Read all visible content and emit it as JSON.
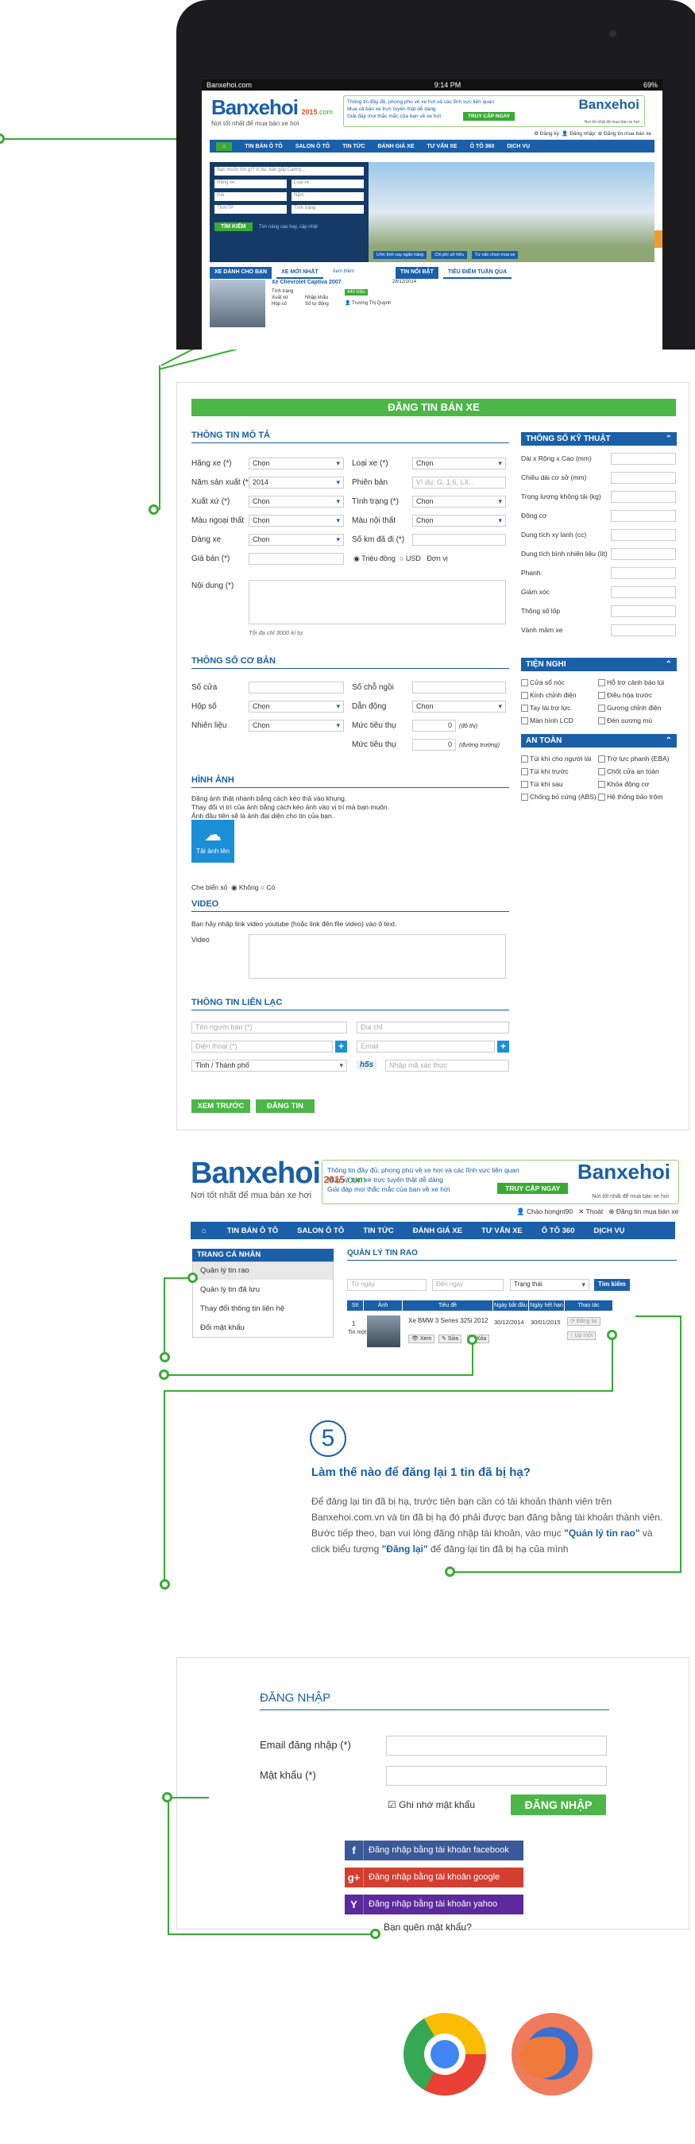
{
  "tablet": {
    "status": {
      "carrier": "Banxehoi.com",
      "time": "9:14 PM",
      "battery": "69%"
    },
    "logo": {
      "brand": "Banxehoi",
      "year": "2015",
      "suffix": ".com",
      "tagline": "Nơi tốt nhất để mua bán xe hơi"
    },
    "ad": {
      "line1": "Thông tin đầy đủ, phong phú về xe hơi và các lĩnh vực liên quan",
      "line2": "Mua và bán xe trực tuyến thật dễ dàng",
      "line3": "Giải đáp mọi thắc mắc của bạn về xe hơi",
      "cta": "TRUY CẬP NGAY",
      "brand": "Banxehoi",
      "tagline": "Nơi tốt nhất để mua bán xe hơi"
    },
    "userbar": [
      "Đăng ký",
      "Đăng nhập",
      "Đăng tin mua bán xe"
    ],
    "nav": [
      "TIN BÁN Ô TÔ",
      "SALON Ô TÔ",
      "TIN TỨC",
      "ĐÁNH GIÁ XE",
      "TƯ VẤN XE",
      "Ô TÔ 360",
      "DỊCH VỤ"
    ],
    "search": {
      "placeholder": "Bạn muốn tìm gì? ví dụ: bán gấp Camry...",
      "f1": "Hãng xe",
      "f2": "Loại xe",
      "f3": "Giá",
      "f4": "Năm",
      "f5": "Tỉnh/TP",
      "f6": "Tình trạng",
      "button": "TÌM KIẾM",
      "link": "Tìm nâng cao hay, cập nhật"
    },
    "banner_chips": [
      "Ước tính vay ngân hàng",
      "Chi phí sở hữu",
      "Tư vấn chọn mua xe"
    ],
    "tabs": [
      "XE DÀNH CHO BẠN",
      "XE MỚI NHẤT",
      "Xem thêm",
      "TIN NỔI BẬT",
      "TIÊU ĐIỂM TUẦN QUA"
    ],
    "car": {
      "title": "Xe Chevrolet Captiva 2007",
      "date": "28/12/2014",
      "rows": [
        "Tình trạng",
        "Xuất xứ",
        "Hộp số"
      ],
      "values": [
        "Nhập khẩu",
        "Số tự động"
      ],
      "price": "440 triệu",
      "seller": "Trương Thị Quỳnh"
    }
  },
  "form": {
    "title": "ĐĂNG TIN BÁN XE",
    "section_desc": "THÔNG TIN MÔ TẢ",
    "left_labels": [
      "Hãng xe (*)",
      "Năm sản xuất (*)",
      "Xuất xứ (*)",
      "Màu ngoại thất",
      "Dáng xe",
      "Giá bán (*)"
    ],
    "left_values": [
      "Chọn",
      "2014",
      "Chọn",
      "Chọn",
      "Chọn",
      ""
    ],
    "mid_labels": [
      "Loại xe (*)",
      "Phiên bản",
      "Tình trạng (*)",
      "Màu nội thất",
      "Số km đã đi (*)"
    ],
    "mid_values": [
      "Chọn",
      "Ví dụ: G, 1.6, LX..",
      "Chọn",
      "Chọn",
      ""
    ],
    "currency": [
      "Triệu đồng",
      "USD",
      "Đơn vị"
    ],
    "content_label": "Nội dung (*)",
    "content_hint": "Tối đa chỉ 3000 kí tự.",
    "spec_title": "THÔNG SỐ KỸ THUẬT",
    "spec_labels": [
      "Dài x Rộng x Cao (mm)",
      "Chiều dài cơ sở (mm)",
      "Trọng lượng không tải (kg)",
      "Động cơ",
      "Dung tích xy lanh (cc)",
      "Dung tích bình nhiên liệu (lít)",
      "Phanh",
      "Giảm xóc",
      "Thông số lốp",
      "Vành mâm xe"
    ],
    "section_basic": "THÔNG SỐ CƠ BẢN",
    "basic_left_labels": [
      "Số cửa",
      "Hộp số",
      "Nhiên liệu"
    ],
    "basic_left_values": [
      "",
      "Chọn",
      "Chọn"
    ],
    "basic_mid_labels": [
      "Số chỗ ngồi",
      "Dẫn động",
      "Mức tiêu thụ",
      "Mức tiêu thụ"
    ],
    "basic_mid_values": [
      "",
      "Chọn",
      "0",
      "0"
    ],
    "basic_units": [
      "(đô thị)",
      "(đường trường)"
    ],
    "amenities_title": "TIỆN NGHI",
    "amenities": [
      "Cửa sổ nóc",
      "Hỗ trợ cảnh báo lùi",
      "Kính chỉnh điện",
      "Điều hòa trước",
      "Tay lái trợ lực",
      "Gương chỉnh điện",
      "Màn hình LCD",
      "Đèn sương mù"
    ],
    "safety_title": "AN TOÀN",
    "safety": [
      "Túi khí cho người lái",
      "Trợ lực phanh (EBA)",
      "Túi khí trước",
      "Chốt cửa an toàn",
      "Túi khí sau",
      "Khóa động cơ",
      "Chống bó cứng (ABS)",
      "Hệ thống báo trộm"
    ],
    "section_images": "HÌNH ẢNH",
    "images_text": [
      "Đăng ảnh thật nhanh bằng cách kéo thả vào khung.",
      "Thay đổi vị trí của ảnh bằng cách kéo ảnh vào vị trí mà bạn muốn.",
      "Ảnh đầu tiên sẽ là ảnh đại diện cho tin của bạn."
    ],
    "upload_label": "Tải ảnh lên",
    "plate_label": "Che biển số",
    "plate_options": [
      "Không",
      "Có"
    ],
    "section_video": "VIDEO",
    "video_text": "Bạn hãy nhập link video youtube (hoặc link đến file video) vào ô text.",
    "video_label": "Video",
    "section_contact": "THÔNG TIN LIÊN LẠC",
    "contact_placeholders": [
      "Tên người bán (*)",
      "Địa chỉ",
      "Điện thoại (*)",
      "Email",
      "Tỉnh / Thành phố"
    ],
    "captcha": "h5s",
    "captcha_placeholder": "Nhập mã xác thực",
    "btn_preview": "XEM TRƯỚC",
    "btn_post": "ĐĂNG TIN"
  },
  "account": {
    "logo": {
      "brand": "Banxehoi",
      "year": "2015",
      "suffix": ".com",
      "tagline": "Nơi tốt nhất để mua bán xe hơi"
    },
    "ad": {
      "line1": "Thông tin đầy đủ, phong phú về xe hơi và các lĩnh vực liên quan",
      "line2": "Mua và bán xe trực tuyến thật dễ dàng",
      "line3": "Giải đáp mọi thắc mắc của bạn về xe hơi",
      "cta": "TRUY CẬP NGAY",
      "brand": "Banxehoi",
      "tagline": "Nơi tốt nhất để mua bán xe hơi"
    },
    "userbar": [
      "Chào hongnt90",
      "Thoát",
      "Đăng tin mua bán xe"
    ],
    "nav": [
      "TIN BÁN Ô TÔ",
      "SALON Ô TÔ",
      "TIN TỨC",
      "ĐÁNH GIÁ XE",
      "TƯ VẤN XE",
      "Ô TÔ 360",
      "DỊCH VỤ"
    ],
    "sidebar_title": "TRANG CÁ NHÂN",
    "sidebar_items": [
      "Quản lý tin rao",
      "Quản lý tin đã lưu",
      "Thay đổi thông tin liên hệ",
      "Đổi mật khẩu"
    ],
    "main_title": "QUẢN LÝ TIN RAO",
    "filters": {
      "from": "Từ ngày",
      "to": "Đến ngày",
      "status": "Trạng thái",
      "button": "Tìm kiếm"
    },
    "columns": [
      "Stt",
      "Ảnh",
      "Tiêu đề",
      "Ngày bắt đầu",
      "Ngày hết hạn",
      "Thao tác"
    ],
    "row": {
      "index": "1",
      "status": "Tin mới",
      "title": "Xe BMW 3 Series 325i 2012",
      "start": "30/12/2014",
      "end": "30/01/2015",
      "actions": [
        "Xem",
        "Sửa",
        "Xóa"
      ],
      "right_actions": [
        "Đăng lại",
        "Up mới"
      ]
    }
  },
  "step": {
    "number": "5",
    "title": "Làm thế nào để đăng lại 1 tin đã bị hạ?",
    "text_before": "Để đăng lại tin đã bị hạ, trước tiên bạn cần có tài khoản thành viên trên Banxehoi.com.vn và tin đã bị hạ đó phải được bạn đăng bằng tài khoản thành viên. Bước tiếp theo, bạn vui lòng đăng nhập tài khoản, vào mục ",
    "hl1": "\"Quản lý tin rao\"",
    "text_mid": " và click biểu tượng ",
    "hl2": "\"Đăng lại\"",
    "text_after": " để đăng lại tin đã bị hạ của mình"
  },
  "login": {
    "title": "ĐĂNG NHẬP",
    "email_label": "Email đăng nhập (*)",
    "password_label": "Mật khẩu (*)",
    "remember": "Ghi nhớ mật khẩu",
    "submit": "ĐĂNG NHẬP",
    "facebook": "Đăng nhập bằng tài khoản facebook",
    "google": "Đăng nhập bằng tài khoản google",
    "yahoo": "Đăng nhập bằng tài khoản yahoo",
    "forgot": "Bạn quên mật khẩu?"
  }
}
